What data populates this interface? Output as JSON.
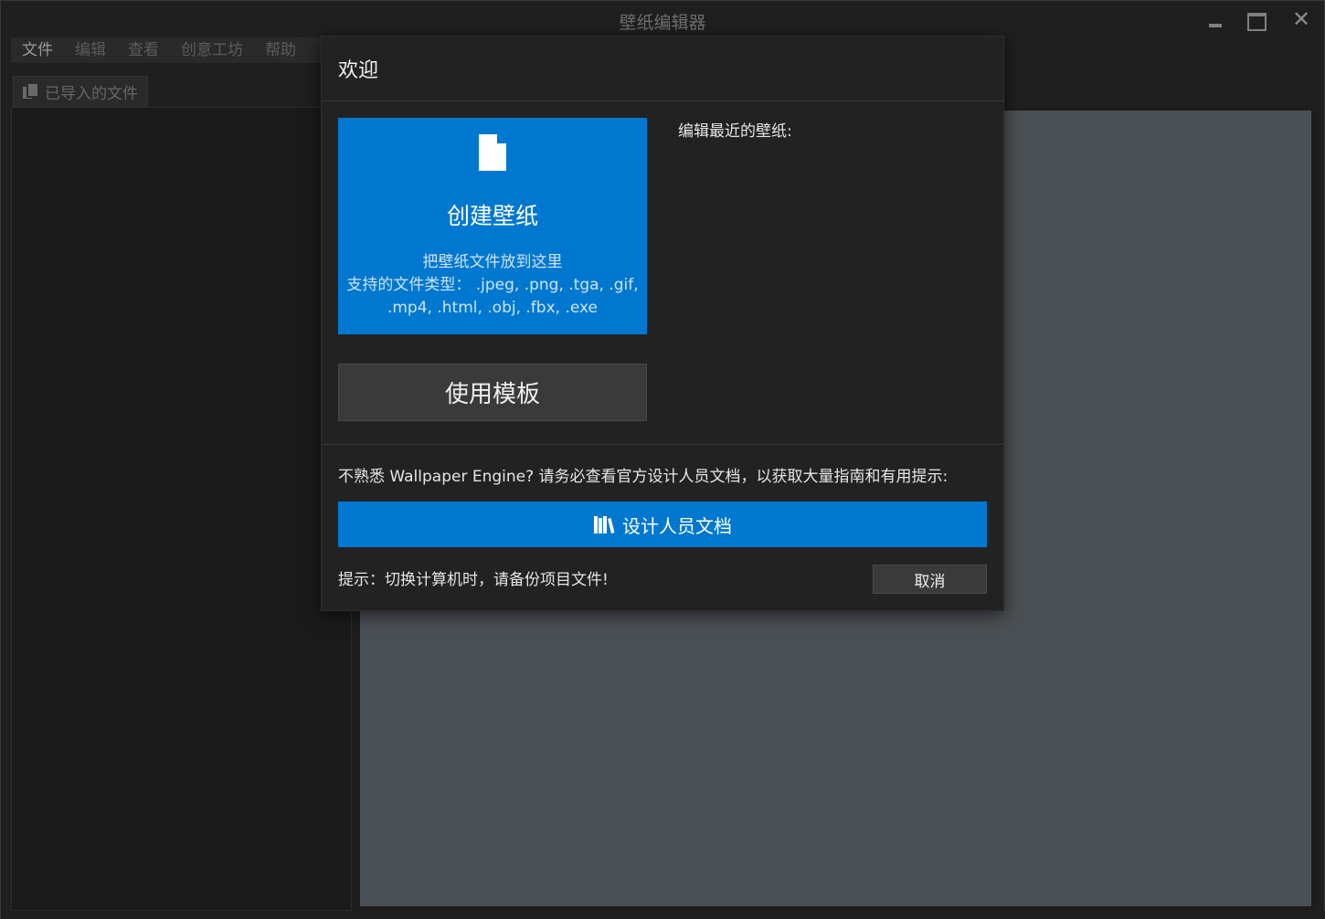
{
  "window": {
    "title": "壁纸编辑器"
  },
  "menu": {
    "items": [
      {
        "label": "文件"
      },
      {
        "label": "编辑"
      },
      {
        "label": "查看"
      },
      {
        "label": "创意工坊"
      },
      {
        "label": "帮助"
      }
    ]
  },
  "left_panel": {
    "tab_label": "已导入的文件",
    "tab_icon": "copy-files-icon"
  },
  "dialog": {
    "title": "欢迎",
    "create": {
      "icon": "file-icon",
      "title": "创建壁纸",
      "line1": "把壁纸文件放到这里",
      "line2": "支持的文件类型： .jpeg, .png, .tga, .gif,",
      "line3": ".mp4, .html, .obj, .fbx, .exe"
    },
    "template_label": "使用模板",
    "recent_label": "编辑最近的壁纸:",
    "hint": "不熟悉 Wallpaper Engine? 请务必查看官方设计人员文档，以获取大量指南和有用提示:",
    "docs_button": {
      "icon": "books-icon",
      "label": "设计人员文档"
    },
    "tip": "提示：切换计算机时，请备份项目文件!",
    "cancel_label": "取消"
  },
  "colors": {
    "accent": "#0078cf",
    "dialog_bg": "#222222",
    "preview_bg": "#4b5054"
  }
}
